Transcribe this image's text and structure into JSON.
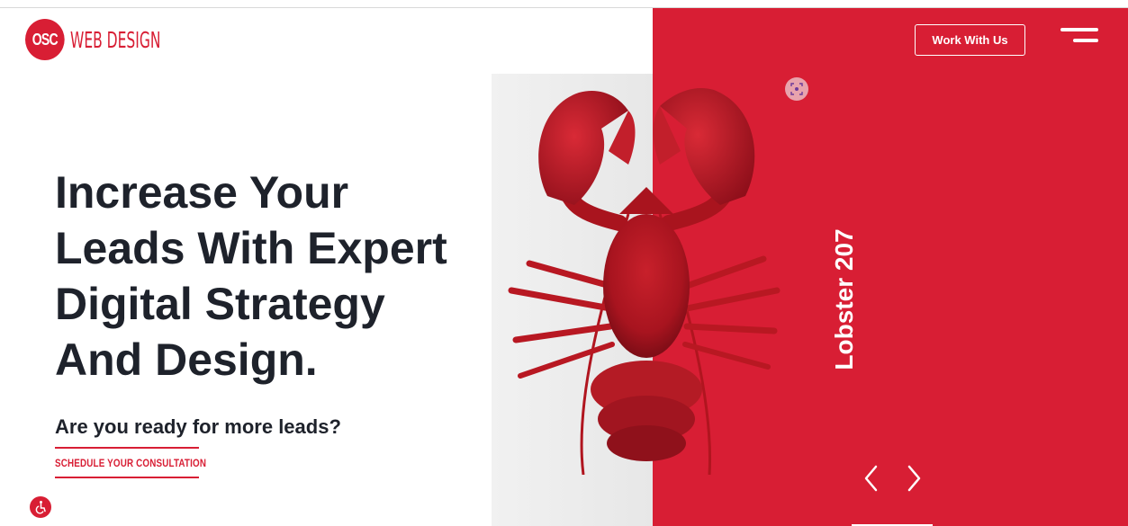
{
  "header": {
    "logo_badge": "OSC",
    "logo_text": "WEB DESIGN",
    "work_button_label": "Work With Us",
    "menu_icon": "hamburger-menu-icon"
  },
  "hero": {
    "headline_lines": [
      "Increase Your",
      "Leads With Expert",
      "Digital Strategy",
      "And Design."
    ],
    "subhead": "Are you ready for more leads?",
    "cta_label": "SCHEDULE YOUR CONSULTATION"
  },
  "slider": {
    "slide_title": "Lobster 207",
    "image": "red-lobster-image",
    "prev_icon": "chevron-left-icon",
    "next_icon": "chevron-right-icon",
    "focus_icon": "focus-target-icon"
  },
  "accessibility": {
    "icon": "wheelchair-accessibility-icon"
  },
  "colors": {
    "brand_red": "#d81e34",
    "headline_dark": "#1e222b",
    "white": "#ffffff"
  }
}
